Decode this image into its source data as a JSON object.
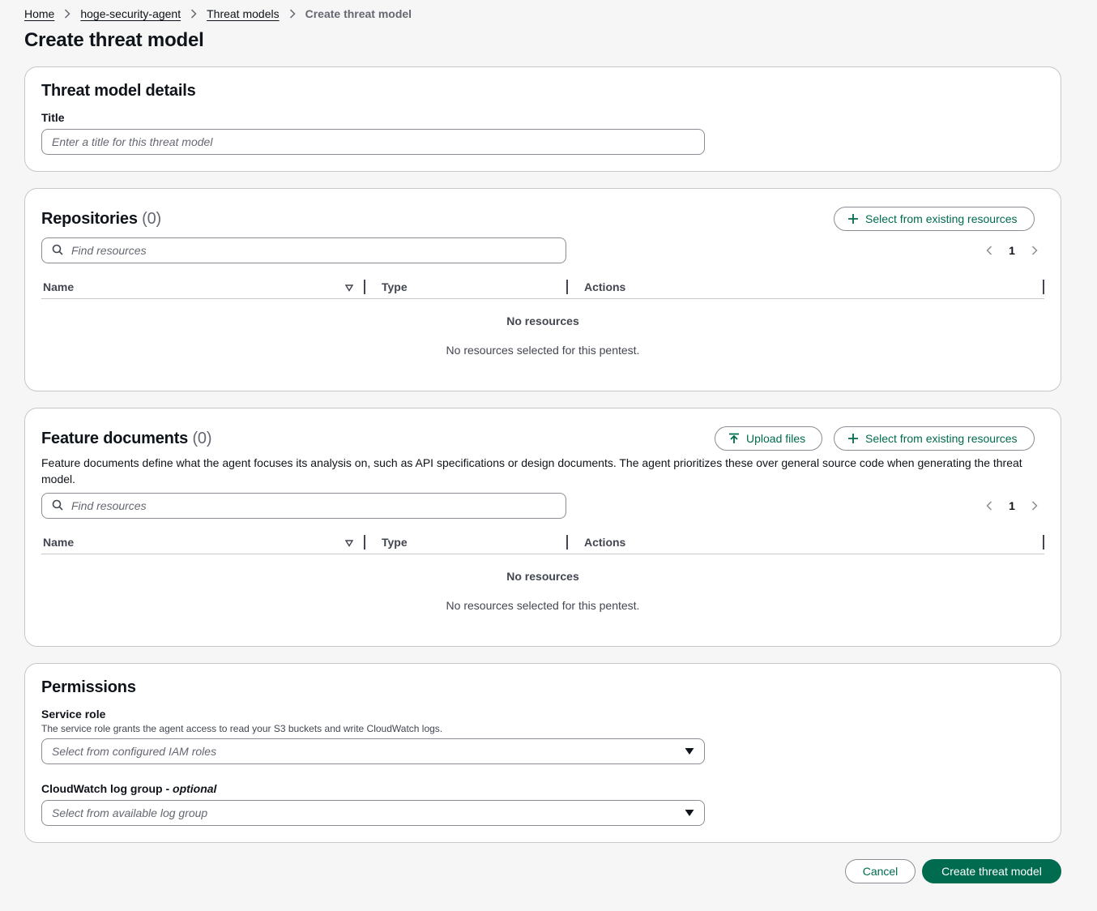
{
  "breadcrumb": {
    "items": [
      "Home",
      "hoge-security-agent",
      "Threat models"
    ],
    "current": "Create threat model"
  },
  "page_title": "Create threat model",
  "details": {
    "heading": "Threat model details",
    "title_label": "Title",
    "title_placeholder": "Enter a title for this threat model",
    "title_value": ""
  },
  "repositories": {
    "heading": "Repositories",
    "count": "(0)",
    "select_button": "Select from existing resources",
    "search_placeholder": "Find resources",
    "page": "1",
    "columns": [
      "Name",
      "Type",
      "Actions"
    ],
    "empty_title": "No resources",
    "empty_desc": "No resources selected for this pentest."
  },
  "feature_documents": {
    "heading": "Feature documents",
    "count": "(0)",
    "upload_button": "Upload files",
    "select_button": "Select from existing resources",
    "description": "Feature documents define what the agent focuses its analysis on, such as API specifications or design documents. The agent prioritizes these over general source code when generating the threat model.",
    "search_placeholder": "Find resources",
    "page": "1",
    "columns": [
      "Name",
      "Type",
      "Actions"
    ],
    "empty_title": "No resources",
    "empty_desc": "No resources selected for this pentest."
  },
  "permissions": {
    "heading": "Permissions",
    "service_role_label": "Service role",
    "service_role_desc": "The service role grants the agent access to read your S3 buckets and write CloudWatch logs.",
    "service_role_placeholder": "Select from configured IAM roles",
    "log_group_label": "CloudWatch log group - ",
    "log_group_optional": "optional",
    "log_group_placeholder": "Select from available log group"
  },
  "footer": {
    "cancel": "Cancel",
    "create": "Create threat model"
  },
  "colors": {
    "accent": "#006b4f",
    "border": "#c6c6cd",
    "background": "#f6f6f6"
  },
  "icons": [
    "chevron-right-icon",
    "search-icon",
    "plus-icon",
    "upload-icon",
    "chevron-left-icon",
    "sort-caret-icon",
    "caret-down-icon"
  ]
}
